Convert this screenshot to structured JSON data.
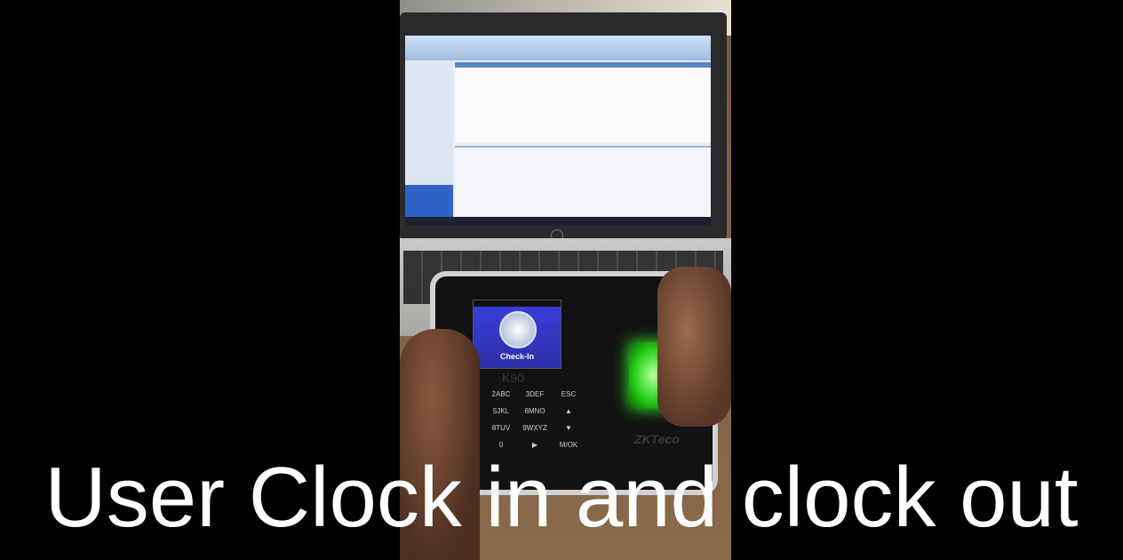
{
  "caption": "User Clock in and clock out",
  "device": {
    "model": "K90",
    "screen_status": "Check-In",
    "brand": "ZKTeco",
    "keypad": [
      "2ABC",
      "3DEF",
      "ESC",
      "5JKL",
      "6MNO",
      "▲",
      "8TUV",
      "9WXYZ",
      "▼",
      "0",
      "▶",
      "M/OK"
    ]
  },
  "icons": {
    "clock": "clock-icon",
    "fingerprint_sensor": "fingerprint-sensor-icon",
    "hp_logo": "hp-logo-icon"
  }
}
